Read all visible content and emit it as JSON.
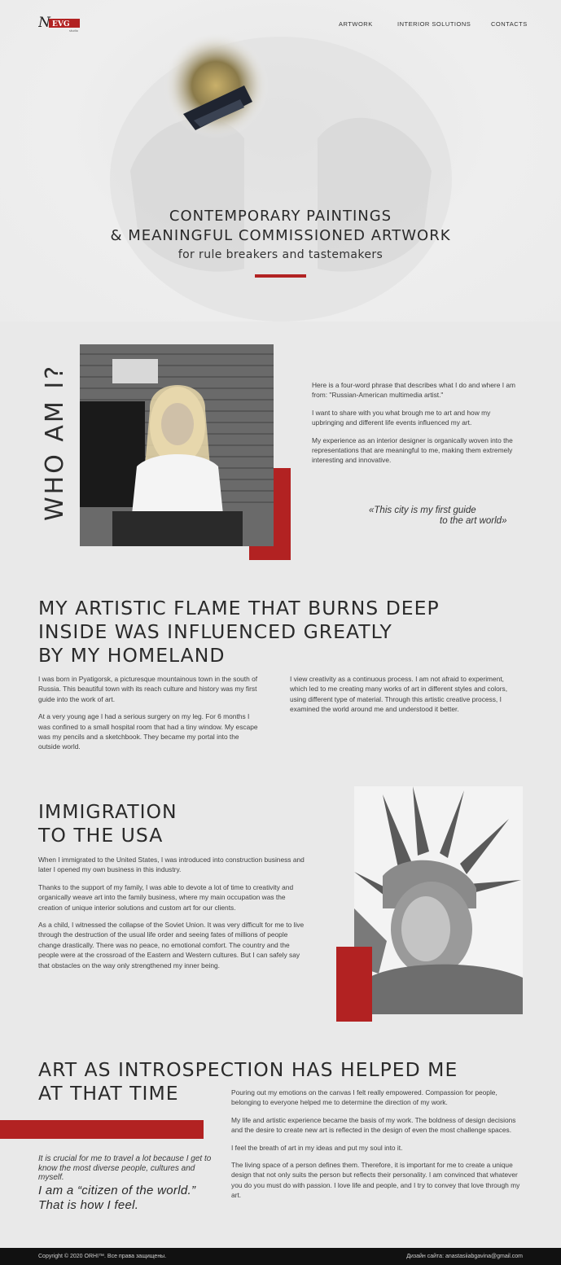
{
  "header": {
    "logo_text": "N EVG",
    "logo_sub": "studio",
    "nav": [
      "ARTWORK",
      "INTERIOR SOLUTIONS",
      "CONTACTS"
    ]
  },
  "hero": {
    "title_line1": "CONTEMPORARY PAINTINGS",
    "title_line2": "& MEANINGFUL COMMISSIONED ARTWORK",
    "subtitle": "for rule breakers and tastemakers",
    "accent_color": "#b22222"
  },
  "who": {
    "heading": "WHO AM I?",
    "paragraphs": [
      "Here is a four-word phrase that describes what I do and where I am from: \"Russian-American multimedia artist.\"",
      "I want to share with you what brough me to art and how my upbringing and different life events influenced my art.",
      "My experience as an interior designer is organically woven into the representations that are meaningful to me, making them extremely interesting and innovative."
    ],
    "quote_line1": "«This city is my first guide",
    "quote_line2": "to the art world»"
  },
  "flame": {
    "heading_lines": [
      "MY ARTISTIC FLAME THAT BURNS DEEP",
      "INSIDE WAS INFLUENCED GREATLY",
      "BY MY HOMELAND"
    ],
    "left_paragraphs": [
      "I was born in Pyatigorsk, a picturesque mountainous town in the south of Russia. This beautiful town with its reach culture and history was my first guide into the work of art.",
      "At a very young age I had a serious surgery on my leg. For 6 months I was confined to a small hospital room that had a tiny window. My escape was my pencils and a sketchbook. They became my portal into the outside world."
    ],
    "right_paragraph": "I view creativity as a continuous process. I am not afraid to experiment, which led to me creating many works of art in different styles and colors, using different type of material. Through this artistic creative process, I examined the world around me and understood it better."
  },
  "immigration": {
    "heading_lines": [
      "IMMIGRATION",
      "TO THE USA"
    ],
    "paragraphs": [
      "When I immigrated to the United States, I was introduced into construction business and later I opened my own business in this industry.",
      "Thanks to the support of my family, I was able to devote a lot of time to creativity and organically weave art into the family business, where my main occupation was the creation of unique interior solutions and custom art for our clients.",
      "As a child, I witnessed the collapse of the Soviet Union. It was very difficult for me to live through the destruction of the usual life order and seeing fates of millions of people change drastically. There was no peace, no emotional comfort. The country and the people were at the crossroad of the Eastern and Western cultures. But I can safely say that obstacles on the way only strengthened my inner being."
    ]
  },
  "introspection": {
    "heading_lines": [
      "ART AS INTROSPECTION HAS HELPED ME",
      "AT THAT TIME"
    ],
    "quote_small": "It is crucial for me to travel a lot because I get to know the most diverse people, cultures and myself.",
    "quote_big": "I am a “citizen of the world.” That is how I feel.",
    "paragraphs": [
      "Pouring out my emotions on the canvas I felt really empowered. Compassion for people, belonging to everyone helped me to determine the direction of my work.",
      "My life and artistic experience became the basis of my work. The boldness of design decisions and the desire to create new art is reflected in the design of even the most challenge spaces.",
      "I feel the breath of art in my ideas and put my soul into it.",
      "The living space of a person defines them. Therefore, it is important for me to create a unique design that not only suits the person but reflects their personality. I am convinced that whatever you do you must do with passion. I love life and people, and I try to convey that love through my art."
    ]
  },
  "footer": {
    "copyright": "Copyright © 2020 ORHI™. Все права защищены.",
    "design_credit": "Дизайн сайта: anastasiiabgavina@gmail.com"
  }
}
